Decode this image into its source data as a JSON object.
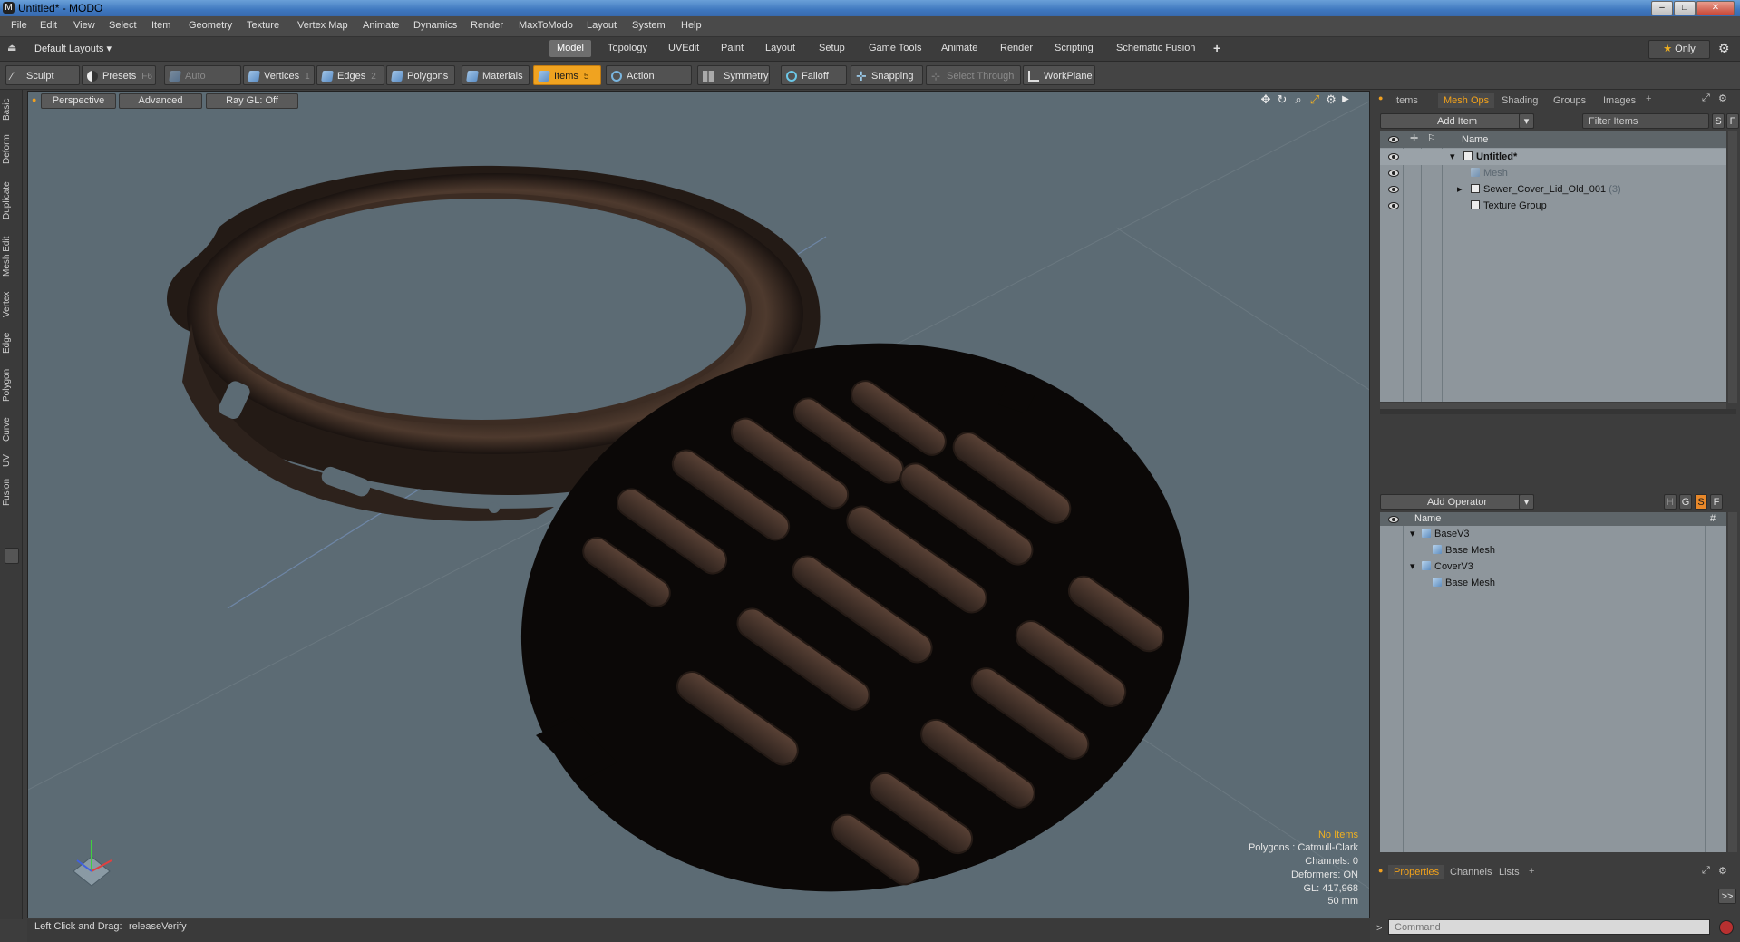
{
  "window": {
    "title": "Untitled* - MODO",
    "minimize": "–",
    "maximize": "□",
    "close": "✕"
  },
  "menu": [
    "File",
    "Edit",
    "View",
    "Select",
    "Item",
    "Geometry",
    "Texture",
    "Vertex Map",
    "Animate",
    "Dynamics",
    "Render",
    "MaxToModo",
    "Layout",
    "System",
    "Help"
  ],
  "layout_bar": {
    "layout_selector": "Default Layouts",
    "tabs": [
      "Model",
      "Topology",
      "UVEdit",
      "Paint",
      "Layout",
      "Setup",
      "Game Tools",
      "Animate",
      "Render",
      "Scripting",
      "Schematic Fusion"
    ],
    "active_tab": "Model",
    "add_tab": "+",
    "only_label": "Only"
  },
  "toolbar": {
    "sculpt": "Sculpt",
    "presets": "Presets",
    "presets_key": "F6",
    "auto_select": "Auto Select",
    "vertices": "Vertices",
    "vertices_key": "1",
    "edges": "Edges",
    "edges_key": "2",
    "polygons": "Polygons",
    "materials": "Materials",
    "items": "Items",
    "items_key": "5",
    "action_center": "Action Center",
    "symmetry": "Symmetry",
    "falloff": "Falloff",
    "snapping": "Snapping",
    "select_through": "Select Through",
    "workplane": "WorkPlane"
  },
  "left_tabs": [
    "Basic",
    "Deform",
    "Duplicate",
    "Mesh Edit",
    "Vertex",
    "Edge",
    "Polygon",
    "Curve",
    "UV",
    "Fusion"
  ],
  "viewport": {
    "view_mode": "Perspective",
    "shading": "Advanced",
    "raygl": "Ray GL: Off",
    "info": {
      "items": "No Items",
      "polygons": "Polygons : Catmull-Clark",
      "channels": "Channels: 0",
      "deformers": "Deformers: ON",
      "gl": "GL: 417,968",
      "scale": "50 mm"
    }
  },
  "items_panel": {
    "tabs": [
      "Items",
      "Mesh Ops",
      "Shading",
      "Groups",
      "Images"
    ],
    "active_tab": "Mesh Ops",
    "add_item": "Add Item",
    "filter_placeholder": "Filter Items",
    "s_btn": "S",
    "f_btn": "F",
    "col_name": "Name",
    "tree": [
      {
        "label": "Untitled*"
      },
      {
        "label": "Mesh"
      },
      {
        "label": "Sewer_Cover_Lid_Old_001",
        "count": "(3)"
      },
      {
        "label": "Texture Group"
      }
    ]
  },
  "meshops_panel": {
    "add_operator": "Add Operator",
    "h_btn": "H",
    "g_btn": "G",
    "s_btn": "S",
    "f_btn": "F",
    "col_name": "Name",
    "col_hash": "#",
    "tree": [
      {
        "label": "BaseV3"
      },
      {
        "label": "Base Mesh"
      },
      {
        "label": "CoverV3"
      },
      {
        "label": "Base Mesh"
      }
    ]
  },
  "properties_panel": {
    "tabs": [
      "Properties",
      "Channels",
      "Lists"
    ],
    "active_tab": "Properties",
    "expand": ">>"
  },
  "command": {
    "placeholder": "Command"
  },
  "status": {
    "hint_label": "Left Click and Drag:",
    "hint_value": "releaseVerify"
  }
}
